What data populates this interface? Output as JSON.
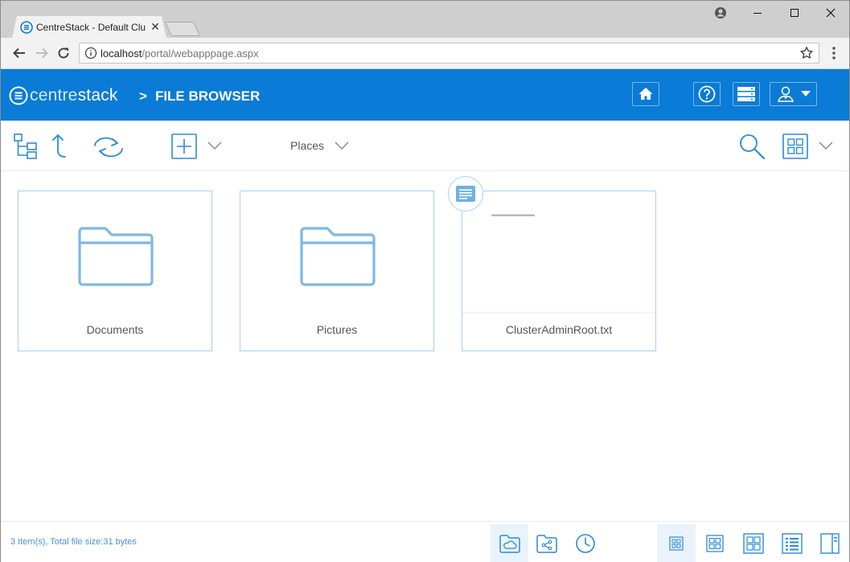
{
  "browser": {
    "tab_title": "CentreStack - Default Clu",
    "url_host": "localhost",
    "url_path": "/portal/webapppage.aspx"
  },
  "app": {
    "logo_text_1": "centre",
    "logo_text_2": "stack",
    "breadcrumb_sep": ">",
    "breadcrumb": "FILE BROWSER",
    "accent_color": "#0a7bd6"
  },
  "toolbar": {
    "places_label": "Places"
  },
  "files": [
    {
      "name": "Documents",
      "type": "folder"
    },
    {
      "name": "Pictures",
      "type": "folder"
    },
    {
      "name": "ClusterAdminRoot.txt",
      "type": "file"
    }
  ],
  "status": {
    "summary": "3 Item(s), Total file size:31 bytes"
  }
}
